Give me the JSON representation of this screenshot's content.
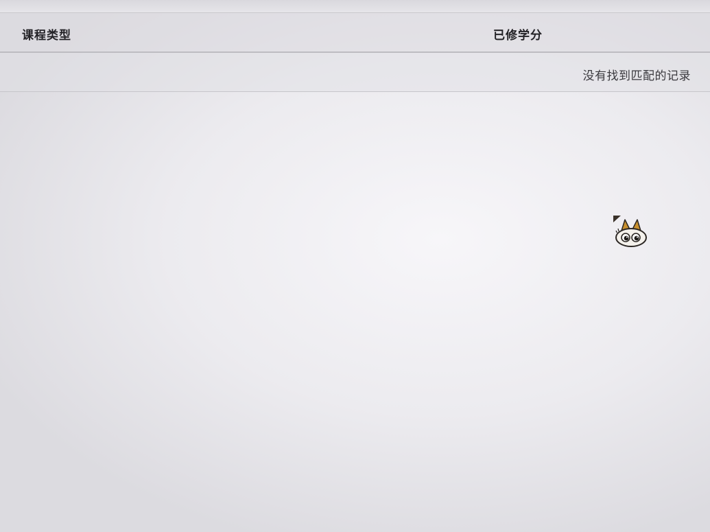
{
  "table": {
    "columns": [
      "课程类型",
      "已修学分"
    ],
    "empty_message": "没有找到匹配的记录"
  },
  "mascot": {
    "icon": "cat-mascot-icon",
    "colors": {
      "ears": "#c8902e",
      "face": "#f4f1ec",
      "outline": "#2b2623"
    }
  }
}
